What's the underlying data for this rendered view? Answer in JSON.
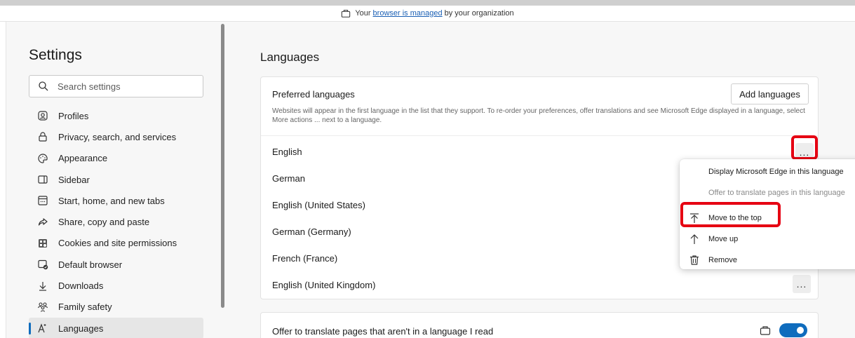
{
  "managed_bar": {
    "prefix": "Your",
    "link": "browser is managed",
    "suffix": "by your organization"
  },
  "sidebar": {
    "title": "Settings",
    "search_placeholder": "Search settings",
    "items": [
      {
        "label": "Profiles",
        "icon": "profile-icon"
      },
      {
        "label": "Privacy, search, and services",
        "icon": "lock-icon"
      },
      {
        "label": "Appearance",
        "icon": "appearance-icon"
      },
      {
        "label": "Sidebar",
        "icon": "sidebar-icon"
      },
      {
        "label": "Start, home, and new tabs",
        "icon": "home-tabs-icon"
      },
      {
        "label": "Share, copy and paste",
        "icon": "share-icon"
      },
      {
        "label": "Cookies and site permissions",
        "icon": "cookies-icon"
      },
      {
        "label": "Default browser",
        "icon": "default-browser-icon"
      },
      {
        "label": "Downloads",
        "icon": "download-icon"
      },
      {
        "label": "Family safety",
        "icon": "family-icon"
      },
      {
        "label": "Languages",
        "icon": "languages-icon",
        "active": true
      }
    ]
  },
  "main": {
    "title": "Languages",
    "preferred": {
      "title": "Preferred languages",
      "description": "Websites will appear in the first language in the list that they support. To re-order your preferences, offer translations and see Microsoft Edge displayed in a language, select More actions ... next to a language.",
      "add_button": "Add languages",
      "more_label": "...",
      "languages": [
        "English",
        "German",
        "English (United States)",
        "German (Germany)",
        "French (France)",
        "English (United Kingdom)"
      ]
    },
    "offer_translate": {
      "label": "Offer to translate pages that aren't in a language I read",
      "enabled": true
    }
  },
  "context_menu": {
    "items": [
      {
        "label": "Display Microsoft Edge in this language",
        "enabled": true
      },
      {
        "label": "Offer to translate pages in this language",
        "enabled": false
      },
      {
        "label": "Move to the top",
        "icon": "move-to-top-icon",
        "enabled": true
      },
      {
        "label": "Move up",
        "icon": "arrow-up-icon",
        "enabled": true
      },
      {
        "label": "Remove",
        "icon": "trash-icon",
        "enabled": true
      }
    ]
  },
  "colors": {
    "accent": "#0f6cbd",
    "highlight": "#e60012"
  }
}
